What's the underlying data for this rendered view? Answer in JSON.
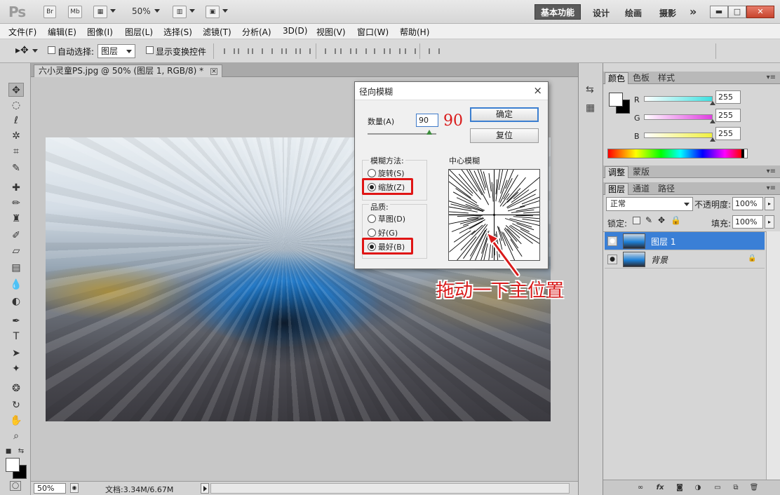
{
  "app": {
    "logo": "Ps",
    "bridge_label": "Br",
    "minibridge_label": "Mb",
    "zoom": "50%",
    "workspaces": [
      "基本功能",
      "设计",
      "绘画",
      "摄影"
    ],
    "more": "»"
  },
  "menu": [
    "文件(F)",
    "编辑(E)",
    "图像(I)",
    "图层(L)",
    "选择(S)",
    "滤镜(T)",
    "分析(A)",
    "3D(D)",
    "视图(V)",
    "窗口(W)",
    "帮助(H)"
  ],
  "options": {
    "auto_select_label": "自动选择:",
    "auto_select_value": "图层",
    "show_transform_label": "显示变换控件"
  },
  "document": {
    "tab_title": "六小灵童PS.jpg @ 50% (图层 1, RGB/8) *",
    "close": "×"
  },
  "status": {
    "zoom": "50%",
    "doc_info": "文档:3.34M/6.67M"
  },
  "dialog": {
    "title": "径向模糊",
    "close": "×",
    "amount_label": "数量(A)",
    "amount_value": "90",
    "amount_annotation": "90",
    "amount_fraction": 0.9,
    "ok": "确定",
    "reset": "复位",
    "method_title": "模糊方法:",
    "methods": [
      {
        "label": "旋转(S)",
        "selected": false
      },
      {
        "label": "缩放(Z)",
        "selected": true
      }
    ],
    "quality_title": "品质:",
    "qualities": [
      {
        "label": "草图(D)",
        "selected": false
      },
      {
        "label": "好(G)",
        "selected": false
      },
      {
        "label": "最好(B)",
        "selected": true
      }
    ],
    "center_label": "中心模糊"
  },
  "annotation": "拖动一下主位置",
  "color_panel": {
    "tabs": [
      "颜色",
      "色板",
      "样式"
    ],
    "channels": [
      {
        "label": "R",
        "value": "255",
        "color": "#3fe0e0"
      },
      {
        "label": "G",
        "value": "255",
        "color": "#e040e0"
      },
      {
        "label": "B",
        "value": "255",
        "color": "#f0f040"
      }
    ]
  },
  "adjust_panel": {
    "tabs": [
      "调整",
      "蒙版"
    ]
  },
  "layers_panel": {
    "tabs": [
      "图层",
      "通道",
      "路径"
    ],
    "blend_mode": "正常",
    "opacity_label": "不透明度:",
    "opacity_value": "100%",
    "lock_label": "锁定:",
    "fill_label": "填充:",
    "fill_value": "100%",
    "layers": [
      {
        "name": "图层 1",
        "selected": true
      },
      {
        "name": "背景",
        "selected": false,
        "locked": true
      }
    ]
  },
  "colors": {
    "accent": "#3c7fd0",
    "selection": "#3a7fd6",
    "annotation_red": "#d91a1a"
  }
}
